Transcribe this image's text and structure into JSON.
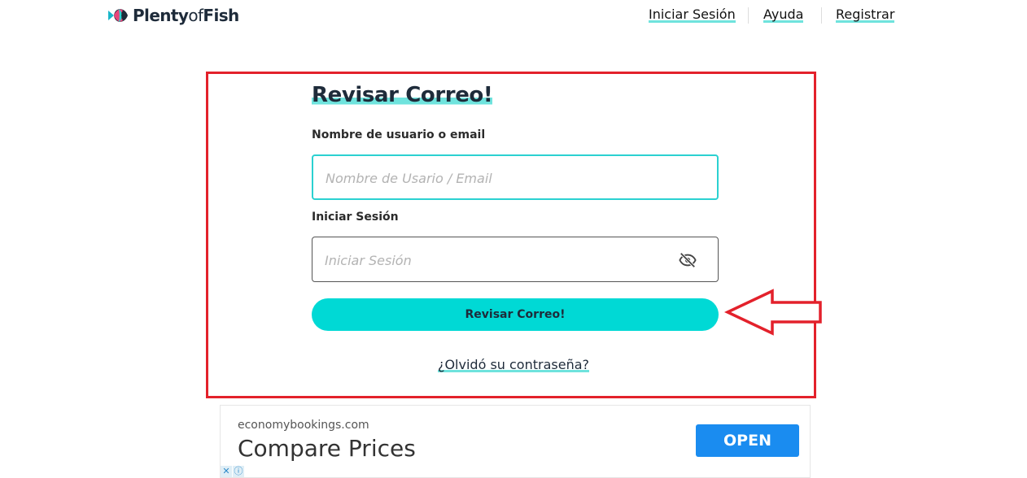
{
  "header": {
    "logo": {
      "word1": "Plenty",
      "word2": "of",
      "word3": "Fish"
    },
    "nav": [
      {
        "label": "Iniciar Sesión"
      },
      {
        "label": "Ayuda"
      },
      {
        "label": "Registrar"
      }
    ]
  },
  "form": {
    "title": "Revisar Correo!",
    "username": {
      "label": "Nombre de usuario o email",
      "placeholder": "Nombre de Usario / Email",
      "value": ""
    },
    "password": {
      "label": "Iniciar Sesión",
      "placeholder": "Iniciar Sesión",
      "value": "",
      "toggle_icon": "eye-off-icon"
    },
    "submit_label": "Revisar Correo!",
    "forgot_link": "¿Olvidó su contraseña?"
  },
  "annotation": {
    "highlight_color": "#e3212b",
    "arrow_icon": "left-arrow-icon"
  },
  "ad": {
    "domain": "economybookings.com",
    "headline": "Compare Prices",
    "button_label": "OPEN",
    "button_color": "#1a8cf0",
    "badges": [
      "close-icon",
      "info-icon"
    ]
  },
  "colors": {
    "accent": "#00d9d5",
    "underline": "#6fe3dd",
    "text": "#1e2b3a"
  }
}
